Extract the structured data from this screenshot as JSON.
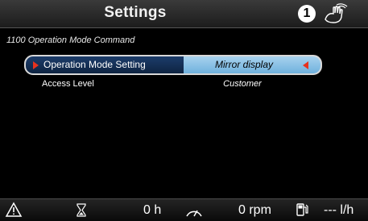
{
  "header": {
    "title": "Settings",
    "info_badge": "1",
    "hand_icon": "hand-touch-icon"
  },
  "breadcrumb": "1100 Operation Mode Command",
  "settings": {
    "rows": [
      {
        "label": "Operation Mode Setting",
        "value": "Mirror display",
        "selected": true
      },
      {
        "label": "Access Level",
        "value": "Customer",
        "selected": false
      }
    ]
  },
  "footer": {
    "warning_icon": "warning-triangle-icon",
    "hours_icon": "hourglass-icon",
    "hours_value": "0 h",
    "rpm_icon": "speedometer-icon",
    "rpm_value": "0 rpm",
    "fuel_icon": "fuel-pump-icon",
    "fuel_value": "--- l/h"
  },
  "colors": {
    "selection_dark": "#0e2442",
    "selection_light": "#6fb1dd",
    "caret": "#e8321e",
    "background": "#000000"
  }
}
